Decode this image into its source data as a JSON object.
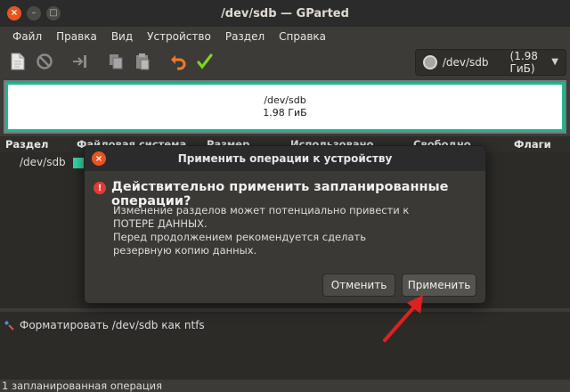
{
  "window": {
    "title": "/dev/sdb — GParted",
    "controls": {
      "close": "×",
      "minimize": "–",
      "maximize": "□"
    }
  },
  "menu": [
    "Файл",
    "Правка",
    "Вид",
    "Устройство",
    "Раздел",
    "Справка"
  ],
  "toolbar": {
    "icons": [
      "new-icon",
      "delete-icon",
      "resize-move-icon",
      "copy-icon",
      "paste-icon",
      "undo-icon",
      "apply-icon"
    ]
  },
  "device_selector": {
    "device": "/dev/sdb",
    "size": "(1.98 ГиБ)"
  },
  "disk_graph": {
    "device": "/dev/sdb",
    "size": "1.98 ГиБ"
  },
  "table": {
    "headers": [
      "Раздел",
      "Файловая система",
      "Размер",
      "Использовано",
      "Свободно",
      "Флаги"
    ],
    "rows": [
      {
        "partition": "/dev/sdb"
      }
    ]
  },
  "operations": {
    "items": [
      {
        "label": "Форматировать /dev/sdb как ntfs"
      }
    ]
  },
  "status": "1 запланированная операция",
  "dialog": {
    "title": "Применить операции к устройству",
    "heading": "Действительно применить запланированные операции?",
    "message_lines": [
      "Изменение разделов может потенциально привести к",
      "ПОТЕРЕ ДАННЫХ.",
      "Перед продолжением рекомендуется сделать",
      "резервную копию данных."
    ],
    "cancel_label": "Отменить",
    "apply_label": "Применить"
  },
  "colors": {
    "accent": "#e95420",
    "partition_border": "#1fb591",
    "ntfs_swatch": "#38d9a9",
    "annotation_arrow": "#e02020"
  }
}
